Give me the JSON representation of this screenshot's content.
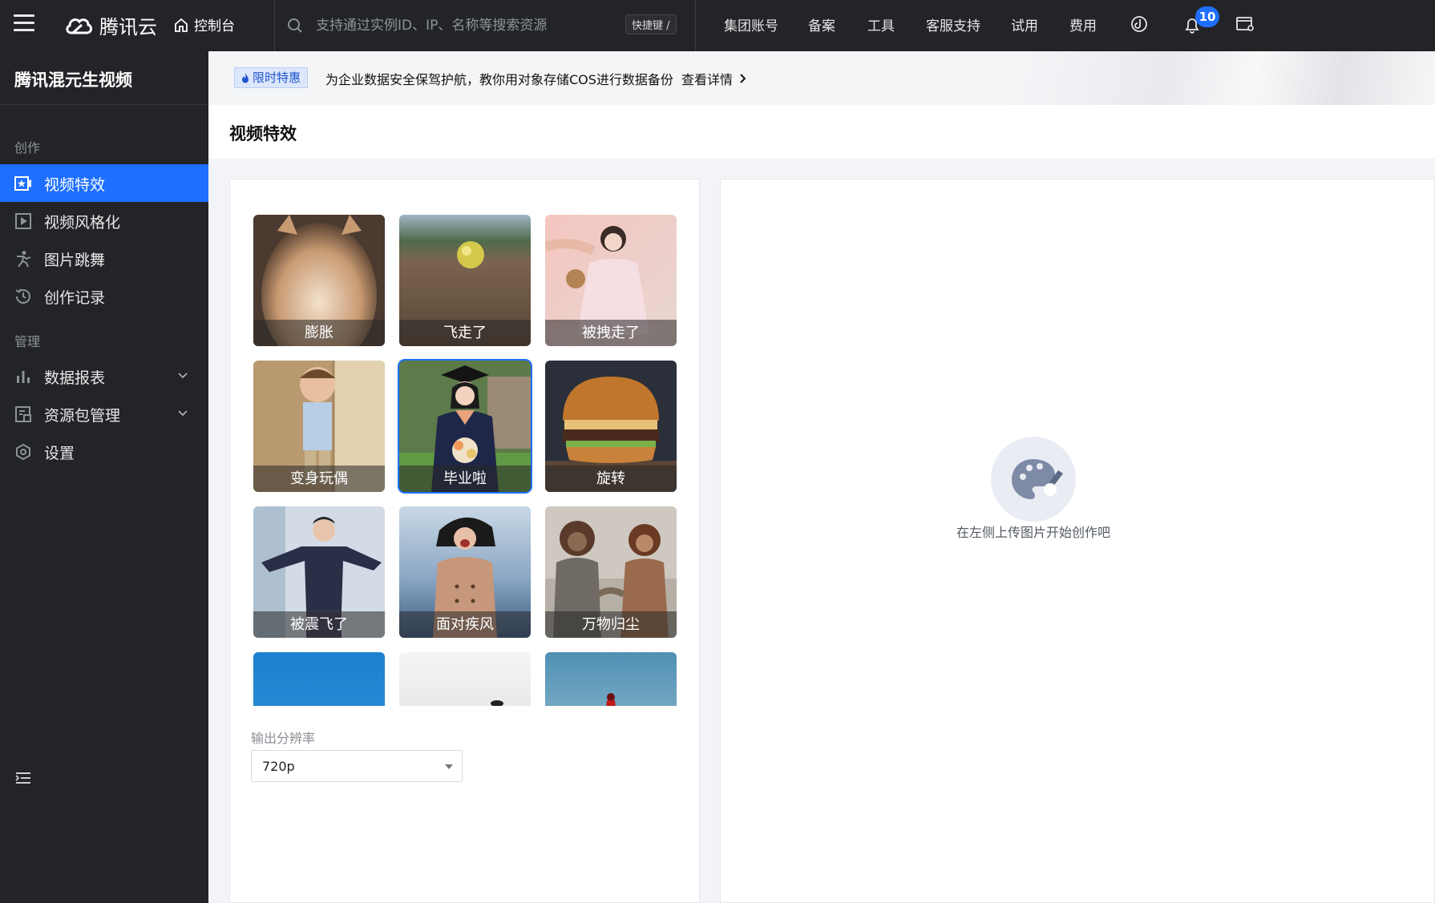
{
  "topbar": {
    "logo_text": "腾讯云",
    "console_label": "控制台",
    "search_placeholder": "支持通过实例ID、IP、名称等搜索资源",
    "shortcut_label": "快捷键 /",
    "nav": [
      "集团账号",
      "备案",
      "工具",
      "客服支持",
      "试用",
      "费用"
    ],
    "notification_count": "10",
    "icons": [
      "menu-icon",
      "tencent-cloud-logo-icon",
      "home-icon",
      "search-icon",
      "bi-icon",
      "bell-icon",
      "window-settings-icon"
    ]
  },
  "sidebar": {
    "title": "腾讯混元生视频",
    "group_create": "创作",
    "group_manage": "管理",
    "items": [
      {
        "label": "视频特效",
        "icon": "video-effect-icon",
        "active": true
      },
      {
        "label": "视频风格化",
        "icon": "play-box-icon",
        "active": false
      },
      {
        "label": "图片跳舞",
        "icon": "dance-icon",
        "active": false
      },
      {
        "label": "创作记录",
        "icon": "history-icon",
        "active": false
      },
      {
        "label": "数据报表",
        "icon": "bar-chart-icon",
        "active": false,
        "expandable": true
      },
      {
        "label": "资源包管理",
        "icon": "package-icon",
        "active": false,
        "expandable": true
      },
      {
        "label": "设置",
        "icon": "settings-icon",
        "active": false
      }
    ]
  },
  "banner": {
    "tag": "限时特惠",
    "text": "为企业数据安全保驾护航，教你用对象存储COS进行数据备份",
    "link": "查看详情"
  },
  "page": {
    "title": "视频特效"
  },
  "effects": [
    {
      "label": "膨胀",
      "selected": false
    },
    {
      "label": "飞走了",
      "selected": false
    },
    {
      "label": "被拽走了",
      "selected": false
    },
    {
      "label": "变身玩偶",
      "selected": false
    },
    {
      "label": "毕业啦",
      "selected": true
    },
    {
      "label": "旋转",
      "selected": false
    },
    {
      "label": "被震飞了",
      "selected": false
    },
    {
      "label": "面对疾风",
      "selected": false
    },
    {
      "label": "万物归尘",
      "selected": false
    }
  ],
  "output": {
    "label": "输出分辨率",
    "value": "720p"
  },
  "preview": {
    "empty_text": "在左侧上传图片开始创作吧"
  },
  "colors": {
    "accent": "#1e6fff",
    "topbar_bg": "#222428",
    "sidebar_bg": "#222428"
  }
}
